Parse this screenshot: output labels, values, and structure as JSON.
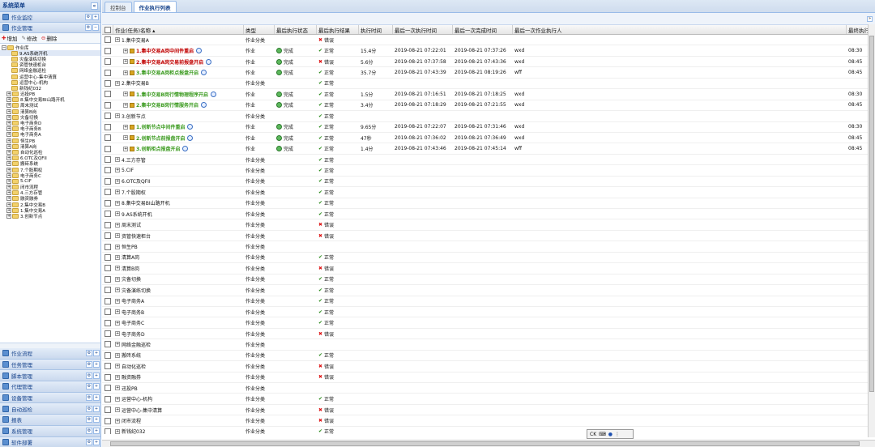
{
  "sidebar": {
    "title": "系统菜单",
    "top_panels": [
      "作业监控",
      "作业管理"
    ],
    "toolbar": {
      "add": "增加",
      "edit": "修改",
      "delete": "删除"
    },
    "tree": [
      "作业库",
      "9.AS系统开机",
      "灾备演练切换",
      "资管快速柜台",
      "网络金融巡检",
      "运营中心-集中清算",
      "运营中心-机构",
      "新钱纪032",
      "迅投PB",
      "8.集中交易BI山路开机",
      "周末测试",
      "清算B岗",
      "灾备切换",
      "电子商务D",
      "电子商务B",
      "电子商务A",
      "恒生PB",
      "清算A岗",
      "自动化巡检",
      "6.OTC及QFII",
      "搬砖系统",
      "7.个股期权",
      "电子商务C",
      "5.CIF",
      "闭市流程",
      "4.三方存管",
      "融资融券",
      "2.集中交易B",
      "1.集中交易A",
      "3.创新节点"
    ],
    "bottom_panels": [
      "作业流程",
      "任务管理",
      "脚本管理",
      "代理管理",
      "设备管理",
      "自动巡检",
      "报表",
      "系统管理",
      "软件部署"
    ]
  },
  "tabs": [
    "控制台",
    "作业执行列表"
  ],
  "columns": {
    "name": "作业(任务)名称 ▴",
    "type": "类型",
    "status": "最后执行状态",
    "result": "最后执行结果",
    "duration": "执行时间",
    "start": "最后一次执行时间",
    "end": "最后一次完成时间",
    "user": "最后一次作业执行人",
    "last": "最终执行"
  },
  "rows": [
    {
      "kind": "cat",
      "name": "1.集中交易A",
      "type": "作业分类",
      "status": "",
      "result": "错误",
      "res_ok": false,
      "dur": "",
      "start": "",
      "end": "",
      "user": "",
      "last": ""
    },
    {
      "kind": "job",
      "red": true,
      "name": "1.集中交易A岗中间件重启",
      "type": "作业",
      "status": "完成",
      "result": "正常",
      "res_ok": true,
      "dur": "15.4分",
      "start": "2019-08-21 07:22:01",
      "end": "2019-08-21 07:37:26",
      "user": "wxd",
      "last": "08:30"
    },
    {
      "kind": "job",
      "red": true,
      "name": "2.集中交易A岗交易前报盘开启",
      "type": "作业",
      "status": "完成",
      "result": "错误",
      "res_ok": false,
      "dur": "5.6分",
      "start": "2019-08-21 07:37:58",
      "end": "2019-08-21 07:43:36",
      "user": "wxd",
      "last": "08:45"
    },
    {
      "kind": "job",
      "red": false,
      "name": "3.集中交易A岗柜点报盘开启",
      "type": "作业",
      "status": "完成",
      "result": "正常",
      "res_ok": true,
      "dur": "35.7分",
      "start": "2019-08-21 07:43:39",
      "end": "2019-08-21 08:19:26",
      "user": "wff",
      "last": "08:45"
    },
    {
      "kind": "cat",
      "name": "2.集中交易B",
      "type": "作业分类",
      "status": "",
      "result": "正常",
      "res_ok": true,
      "dur": "",
      "start": "",
      "end": "",
      "user": "",
      "last": ""
    },
    {
      "kind": "job",
      "red": false,
      "name": "1.集中交易B岗行情物理程序开启",
      "type": "作业",
      "status": "完成",
      "result": "正常",
      "res_ok": true,
      "dur": "1.5分",
      "start": "2019-08-21 07:16:51",
      "end": "2019-08-21 07:18:25",
      "user": "wxd",
      "last": "08:30"
    },
    {
      "kind": "job",
      "red": false,
      "name": "2.集中交易B岗行情服务开启",
      "type": "作业",
      "status": "完成",
      "result": "正常",
      "res_ok": true,
      "dur": "3.4分",
      "start": "2019-08-21 07:18:29",
      "end": "2019-08-21 07:21:55",
      "user": "wxd",
      "last": "08:45"
    },
    {
      "kind": "cat",
      "name": "3.创新节点",
      "type": "作业分类",
      "status": "",
      "result": "正常",
      "res_ok": true,
      "dur": "",
      "start": "",
      "end": "",
      "user": "",
      "last": ""
    },
    {
      "kind": "job",
      "red": false,
      "name": "1.创新节点中间件重启",
      "type": "作业",
      "status": "完成",
      "result": "正常",
      "res_ok": true,
      "dur": "9.65分",
      "start": "2019-08-21 07:22:07",
      "end": "2019-08-21 07:31:46",
      "user": "wxd",
      "last": "08:30"
    },
    {
      "kind": "job",
      "red": false,
      "name": "2.创新节点前报盘开启",
      "type": "作业",
      "status": "完成",
      "result": "正常",
      "res_ok": true,
      "dur": "47秒",
      "start": "2019-08-21 07:36:02",
      "end": "2019-08-21 07:36:49",
      "user": "wxd",
      "last": "08:45"
    },
    {
      "kind": "job",
      "red": false,
      "name": "3.创新柜点报盘开启",
      "type": "作业",
      "status": "完成",
      "result": "正常",
      "res_ok": true,
      "dur": "1.4分",
      "start": "2019-08-21 07:43:46",
      "end": "2019-08-21 07:45:14",
      "user": "wff",
      "last": "08:45"
    },
    {
      "kind": "cat",
      "name": "4.三方存管",
      "type": "作业分类",
      "status": "",
      "result": "正常",
      "res_ok": true
    },
    {
      "kind": "cat",
      "name": "5.CIF",
      "type": "作业分类",
      "status": "",
      "result": "正常",
      "res_ok": true
    },
    {
      "kind": "cat",
      "name": "6.OTC及QFII",
      "type": "作业分类",
      "status": "",
      "result": "正常",
      "res_ok": true
    },
    {
      "kind": "cat",
      "name": "7.个股期权",
      "type": "作业分类",
      "status": "",
      "result": "正常",
      "res_ok": true
    },
    {
      "kind": "cat",
      "name": "8.集中交易BI山路开机",
      "type": "作业分类",
      "status": "",
      "result": "正常",
      "res_ok": true
    },
    {
      "kind": "cat",
      "name": "9.AS系统开机",
      "type": "作业分类",
      "status": "",
      "result": "正常",
      "res_ok": true
    },
    {
      "kind": "cat",
      "name": "周末测试",
      "type": "作业分类",
      "status": "",
      "result": "错误",
      "res_ok": false
    },
    {
      "kind": "cat",
      "name": "资管快速柜台",
      "type": "作业分类",
      "status": "",
      "result": "错误",
      "res_ok": false
    },
    {
      "kind": "cat",
      "name": "恒生PB",
      "type": "作业分类",
      "status": "",
      "result": "",
      "res_ok": true
    },
    {
      "kind": "cat",
      "name": "清算A岗",
      "type": "作业分类",
      "status": "",
      "result": "正常",
      "res_ok": true
    },
    {
      "kind": "cat",
      "name": "清算B岗",
      "type": "作业分类",
      "status": "",
      "result": "错误",
      "res_ok": false
    },
    {
      "kind": "cat",
      "name": "灾备切换",
      "type": "作业分类",
      "status": "",
      "result": "正常",
      "res_ok": true
    },
    {
      "kind": "cat",
      "name": "灾备演练切换",
      "type": "作业分类",
      "status": "",
      "result": "正常",
      "res_ok": true
    },
    {
      "kind": "cat",
      "name": "电子商务A",
      "type": "作业分类",
      "status": "",
      "result": "正常",
      "res_ok": true
    },
    {
      "kind": "cat",
      "name": "电子商务B",
      "type": "作业分类",
      "status": "",
      "result": "正常",
      "res_ok": true
    },
    {
      "kind": "cat",
      "name": "电子商务C",
      "type": "作业分类",
      "status": "",
      "result": "正常",
      "res_ok": true
    },
    {
      "kind": "cat",
      "name": "电子商务D",
      "type": "作业分类",
      "status": "",
      "result": "错误",
      "res_ok": false
    },
    {
      "kind": "cat",
      "name": "网络金融巡检",
      "type": "作业分类",
      "status": "",
      "result": "",
      "res_ok": true
    },
    {
      "kind": "cat",
      "name": "搬砖系统",
      "type": "作业分类",
      "status": "",
      "result": "正常",
      "res_ok": true
    },
    {
      "kind": "cat",
      "name": "自动化巡检",
      "type": "作业分类",
      "status": "",
      "result": "错误",
      "res_ok": false
    },
    {
      "kind": "cat",
      "name": "融资融券",
      "type": "作业分类",
      "status": "",
      "result": "错误",
      "res_ok": false
    },
    {
      "kind": "cat",
      "name": "迅投PB",
      "type": "作业分类",
      "status": "",
      "result": "",
      "res_ok": true
    },
    {
      "kind": "cat",
      "name": "运营中心-机构",
      "type": "作业分类",
      "status": "",
      "result": "正常",
      "res_ok": true
    },
    {
      "kind": "cat",
      "name": "运营中心-集中清算",
      "type": "作业分类",
      "status": "",
      "result": "错误",
      "res_ok": false
    },
    {
      "kind": "cat",
      "name": "闭市流程",
      "type": "作业分类",
      "status": "",
      "result": "错误",
      "res_ok": false
    },
    {
      "kind": "cat",
      "name": "新钱纪032",
      "type": "作业分类",
      "status": "",
      "result": "正常",
      "res_ok": true
    }
  ],
  "ime": {
    "label": "CK"
  }
}
